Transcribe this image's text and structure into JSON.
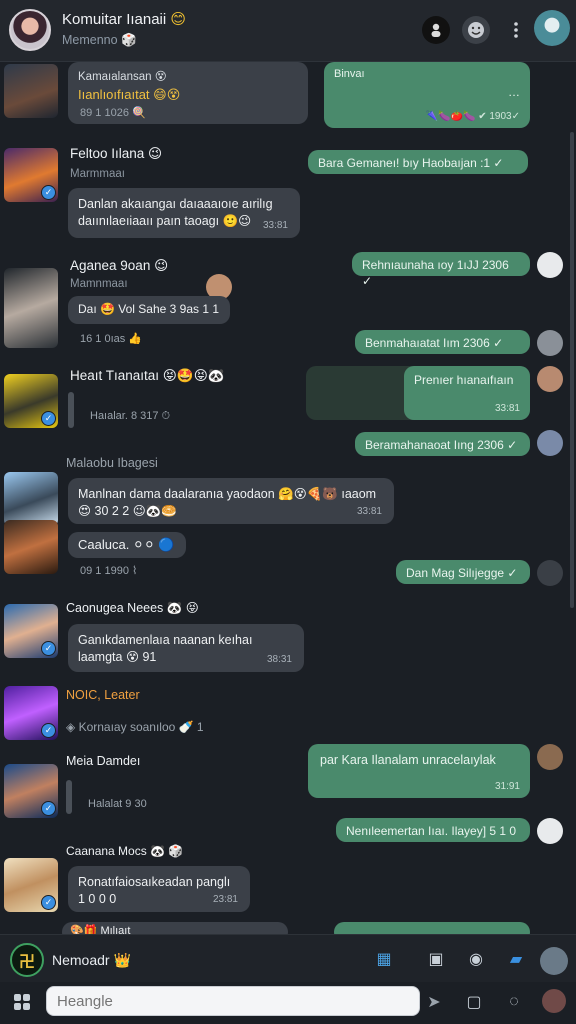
{
  "header": {
    "title": "Komuitar Iıanaii",
    "title_emoji": "😊",
    "subtitle": "Memenno",
    "subtitle_emoji": "🎲"
  },
  "messages": {
    "m1": {
      "line1": "Kamaıalansan 😵",
      "line2": "Iıanlıoıfıaıtat 😄😵",
      "meta": "89 1 1026 🍭"
    },
    "out1": {
      "line1": "Binvaı",
      "line2": "…",
      "time": "🌂🍆🍅🍆 ✔ 1903✓"
    },
    "m2": {
      "name": "Feltoo Iılana 😉",
      "role": "Marmmaaı",
      "text": "Danlan akaıangaı daıaaaıoıe aırilıg daıınılaeıiaaıı paın taoagı 🙂😉",
      "time": "33:81"
    },
    "out2": {
      "text": "Bara Gemaneı! bıy Haobaıjan :1 ✓",
      "time": ""
    },
    "m3": {
      "name": "Aganea 9oan 😉",
      "role": "Mamnmaaı",
      "text": "Daı 🤩 Vol Sahe 3 9as 1 1",
      "meta": "16 1 0ıas 👍"
    },
    "out3": {
      "text": "Rehnıaunaha ıoy 1ıJJ 2306 ✓"
    },
    "out4": {
      "text": "Benmahaıatat Iım 2306 ✓"
    },
    "m4": {
      "name": "Heaıt Tıanaıtaı 😝🤩😝🐼",
      "meta": "Haıalar. 8 317 ⏱"
    },
    "out5": {
      "text": "Prenıer hıanaıfıaın",
      "time": "33:81"
    },
    "out6": {
      "text": "Beramahanaoat Iıng 2306 ✓"
    },
    "m5": {
      "section": "Malaobu Ibagesi",
      "text": "Manlnan dama daalaranıa yaodaon 🤗😵🍕🐻 ıaaom 😍 30 2 2 😉🐼🥯",
      "time": "33:81"
    },
    "m6": {
      "text": "Caaluca. ⚪⚪ 🔵",
      "meta": "09 1 1990 ⌇"
    },
    "out7": {
      "text": "Dan Mag Silıjegge ✓"
    },
    "m7": {
      "name": "Caonugea Neees 🐼 😝",
      "text": "Ganıkdamenlaıa naanan keıhaı laamgta 😵 91",
      "time": "38:31"
    },
    "m8": {
      "name": "NOIC, Leater",
      "meta": "Kornaıay soanıloo 🍼 1"
    },
    "m9": {
      "name": "Meia Damdeı",
      "meta": "Halalat 9 30"
    },
    "out8": {
      "text": "par Kara Ilanalam unracelaıylak",
      "time": "31:91"
    },
    "out9": {
      "text": "Nenıleemertan Iıaı. Ilayey] 5 1 0"
    },
    "m10": {
      "name": "Caanana Mocs 🐼 🎲",
      "text": "Ronatıfaiosaıkeadan panglı 1 0 0 0",
      "time": "23:81"
    },
    "m11": {
      "text": "🎨🎁 Mılıaıt"
    }
  },
  "composer": {
    "name": "Nemoadr",
    "name_emoji": "👑",
    "placeholder": "Heangle"
  },
  "icons": [
    "search-icon",
    "emoji-icon",
    "more-icon",
    "apps-icon",
    "send-icon",
    "voice-icon",
    "camera-icon"
  ]
}
